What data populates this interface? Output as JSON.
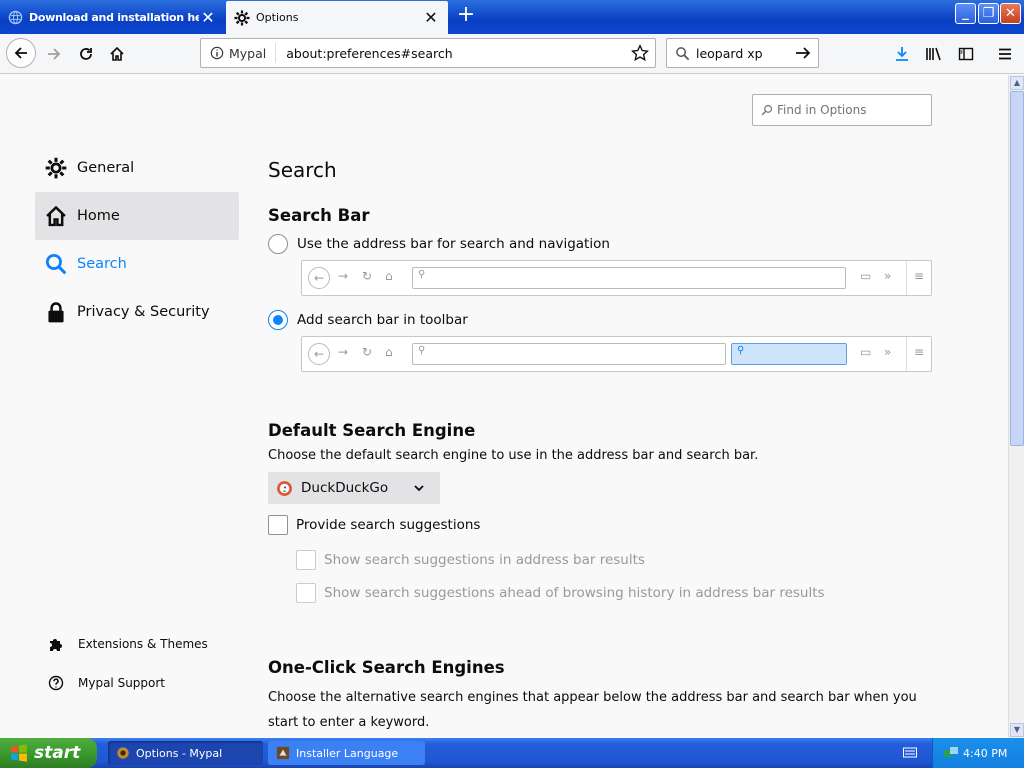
{
  "tabs": [
    {
      "title": "Download and installation help",
      "close": "✕"
    },
    {
      "title": "Options",
      "close": "✕"
    }
  ],
  "window_controls": {
    "minimize": "_",
    "maximize": "❐",
    "close": "✕"
  },
  "navbar": {
    "identity_label": "Mypal",
    "url": "about:preferences#search",
    "search_query": "leopard xp"
  },
  "find": {
    "placeholder": "Find in Options"
  },
  "sidebar": {
    "items": [
      {
        "label": "General",
        "icon": "gear-icon"
      },
      {
        "label": "Home",
        "icon": "home-icon"
      },
      {
        "label": "Search",
        "icon": "search-icon"
      },
      {
        "label": "Privacy & Security",
        "icon": "lock-icon"
      }
    ],
    "footer": [
      {
        "label": "Extensions & Themes",
        "icon": "puzzle-icon"
      },
      {
        "label": "Mypal Support",
        "icon": "help-icon"
      }
    ]
  },
  "main": {
    "title": "Search",
    "search_bar": {
      "heading": "Search Bar",
      "option_address": "Use the address bar for search and navigation",
      "option_toolbar": "Add search bar in toolbar",
      "selected": "toolbar"
    },
    "default_engine": {
      "heading": "Default Search Engine",
      "description": "Choose the default search engine to use in the address bar and search bar.",
      "engine": "DuckDuckGo",
      "provide_suggestions": "Provide search suggestions",
      "show_in_address": "Show search suggestions in address bar results",
      "show_ahead": "Show search suggestions ahead of browsing history in address bar results"
    },
    "one_click": {
      "heading": "One-Click Search Engines",
      "description": "Choose the alternative search engines that appear below the address bar and search bar when you start to enter a keyword."
    }
  },
  "taskbar": {
    "start": "start",
    "tasks": [
      {
        "label": "Options - Mypal"
      },
      {
        "label": "Installer Language"
      }
    ],
    "clock": "4:40 PM"
  },
  "colors": {
    "accent": "#0a84ff",
    "title_bar": "#0a3fc4",
    "taskbar": "#245edb",
    "start": "#37962a"
  }
}
